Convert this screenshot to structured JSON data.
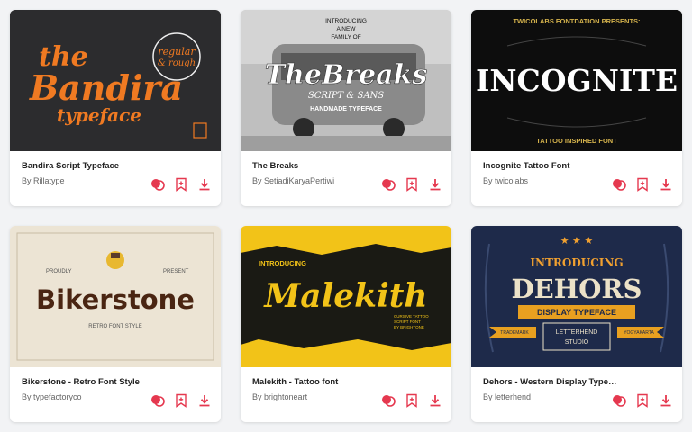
{
  "colors": {
    "accent": "#e5384f",
    "card_bg": "#ffffff",
    "page_bg": "#f2f3f5"
  },
  "cards": [
    {
      "title": "Bandira Script Typeface",
      "by_label": "By",
      "author": "Rillatype",
      "thumb": {
        "line1": "the",
        "line2": "Bandira",
        "line3": "typeface",
        "badge1": "regular",
        "badge2": "& rough"
      }
    },
    {
      "title": "The Breaks",
      "by_label": "By",
      "author": "SetiadiKaryaPertiwi",
      "thumb": {
        "top1": "INTRODUCING",
        "top2": "A NEW",
        "top3": "FAMILY OF",
        "main": "TheBreaks",
        "sub": "SCRIPT & SANS",
        "bottom": "HANDMADE TYPEFACE"
      }
    },
    {
      "title": "Incognite Tattoo Font",
      "by_label": "By",
      "author": "twicolabs",
      "thumb": {
        "header": "TWICOLABS FONTDATION PRESENTS:",
        "main": "INCOGNITE",
        "footer": "TATTOO INSPIRED FONT"
      }
    },
    {
      "title": "Bikerstone - Retro Font Style",
      "by_label": "By",
      "author": "typefactoryco",
      "thumb": {
        "left": "PROUDLY",
        "right": "PRESENT",
        "main": "Bikerstone",
        "sub": "RETRO FONT STYLE"
      }
    },
    {
      "title": "Malekith - Tattoo font",
      "by_label": "By",
      "author": "brightoneart",
      "thumb": {
        "intro": "INTRODUCING",
        "main": "Malekith",
        "sub1": "CURSIVE TATTOO",
        "sub2": "SCRIPT FONT",
        "sub3": "BY BRIGHTONE"
      }
    },
    {
      "title": "Dehors - Western Display Typeface",
      "by_label": "By",
      "author": "letterhend",
      "thumb": {
        "intro": "INTRODUCING",
        "main": "DEHORS",
        "ribbon": "DISPLAY TYPEFACE",
        "left": "TRADEMARK",
        "right": "YOGYAKARTA",
        "studio1": "LETTERHEND",
        "studio2": "STUDIO"
      }
    }
  ]
}
